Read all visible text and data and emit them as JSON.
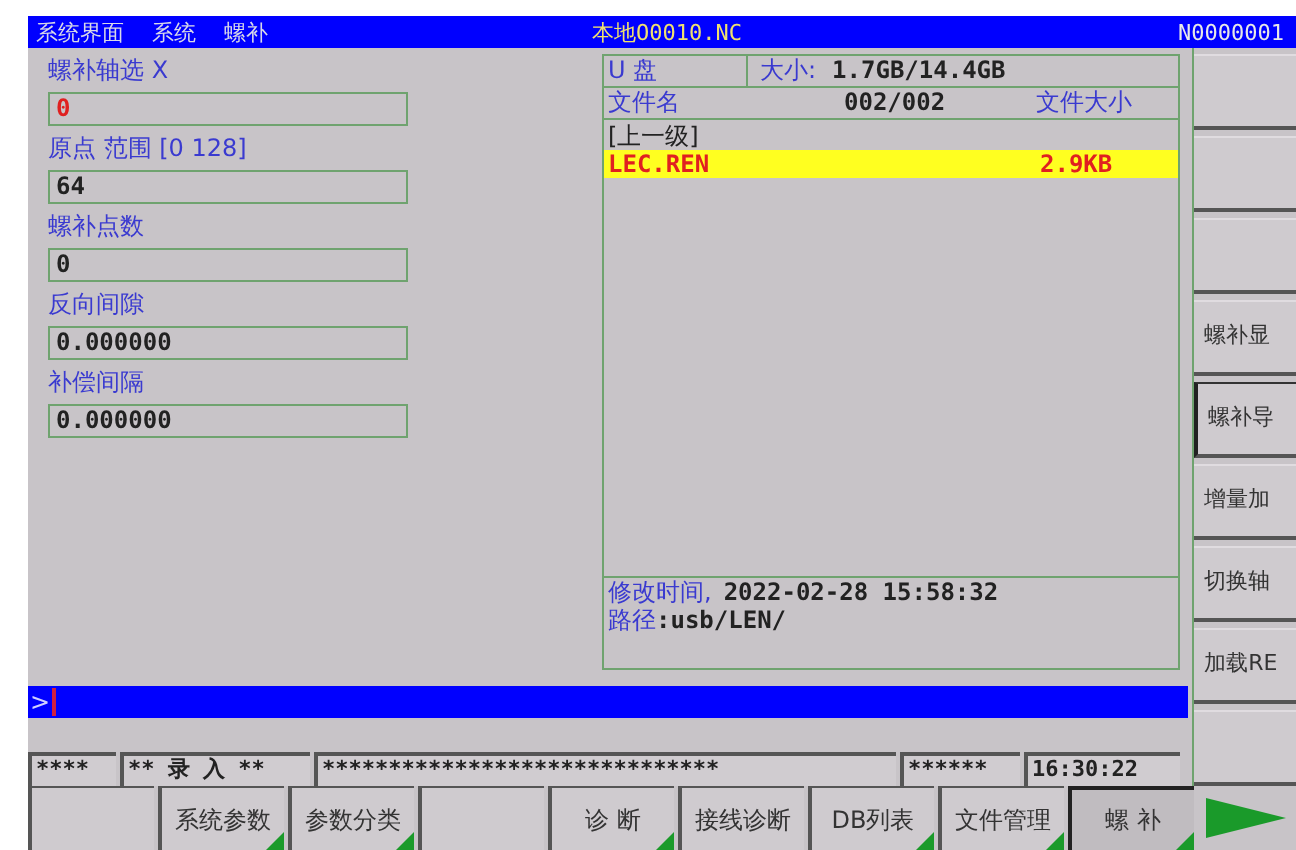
{
  "title_bar": {
    "breadcrumb": [
      "系统界面",
      "系统",
      "螺补"
    ],
    "program": "本地O0010.NC",
    "block": "N0000001"
  },
  "fields": [
    {
      "label": "螺补轴选 X",
      "value": "0",
      "active": true
    },
    {
      "label": "原点 范围 [0 128]",
      "value": "64",
      "active": false
    },
    {
      "label": "螺补点数",
      "value": "0",
      "active": false
    },
    {
      "label": "反向间隙",
      "value": "0.000000",
      "active": false
    },
    {
      "label": "补偿间隔",
      "value": "0.000000",
      "active": false
    }
  ],
  "file_panel": {
    "device": "U 盘",
    "size_label": "大小:",
    "size": "1.7GB/14.4GB",
    "name_header": "文件名",
    "count": "002/002",
    "size_header": "文件大小",
    "rows": [
      {
        "name": "[上一级]",
        "selected": false
      },
      {
        "name": "LEC.REN",
        "size": "2.9KB",
        "selected": true
      }
    ],
    "modified_label": "修改时间,",
    "modified_value": "2022-02-28 15:58:32",
    "path_label": "路径",
    "path_value": ":usb/LEN/"
  },
  "command_line": {
    "prompt": ">"
  },
  "status_bar": [
    "****",
    "** 录 入 **",
    "******************************",
    "******",
    "16:30:22"
  ],
  "side_softkeys": [
    {
      "selected": false
    },
    {
      "selected": false
    },
    {
      "selected": false
    },
    {
      "label": "螺补显",
      "selected": false
    },
    {
      "label": "螺补导",
      "selected": true
    },
    {
      "label": "增量加",
      "selected": false
    },
    {
      "label": "切换轴",
      "selected": false
    },
    {
      "label": "加载RE",
      "selected": false
    },
    {
      "selected": false
    }
  ],
  "bottom_softkeys": [
    {
      "selected": false,
      "submenu": false
    },
    {
      "label": "系统参数",
      "selected": false,
      "submenu": true
    },
    {
      "label": "参数分类",
      "selected": false,
      "submenu": true
    },
    {
      "selected": false,
      "submenu": false
    },
    {
      "label": "诊 断",
      "selected": false,
      "submenu": true
    },
    {
      "label": "接线诊断",
      "selected": false,
      "submenu": false
    },
    {
      "label": "DB列表",
      "selected": false,
      "submenu": true
    },
    {
      "label": "文件管理",
      "selected": false,
      "submenu": true
    },
    {
      "label": "螺 补",
      "selected": true,
      "submenu": true
    }
  ]
}
